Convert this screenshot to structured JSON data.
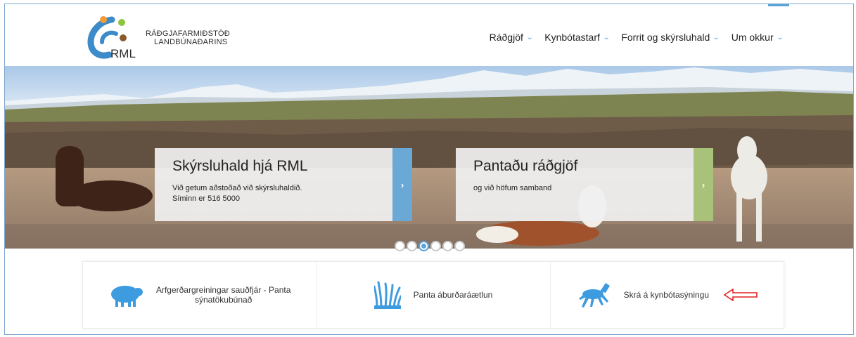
{
  "brand": {
    "name_line1": "RÁÐGJAFARMIÐSTÖÐ",
    "name_line2": "LANDBÚNAÐARINS",
    "logo_text": "RML",
    "colors": {
      "orange": "#f39c34",
      "green": "#8cc63f",
      "brown": "#8b5a2b",
      "blue": "#3d8bc9"
    }
  },
  "nav": {
    "items": [
      {
        "label": "Ráðgjöf",
        "icon": "chevron-down-icon"
      },
      {
        "label": "Kynbótastarf",
        "icon": "chevron-down-icon"
      },
      {
        "label": "Forrit og skýrsluhald",
        "icon": "chevron-down-icon"
      },
      {
        "label": "Um okkur",
        "icon": "chevron-down-icon"
      }
    ]
  },
  "hero": {
    "slides": [
      {
        "title": "Skýrsluhald hjá RML",
        "line1": "Við getum aðstoðað við skýrsluhaldið.",
        "line2": "Síminn er  516 5000",
        "arrow": "›",
        "accent": "#6aa8d6"
      },
      {
        "title": "Pantaðu ráðgjöf",
        "line1": "og við höfum samband",
        "arrow": "›",
        "accent": "#a8c27a"
      }
    ],
    "pager": {
      "count": 6,
      "active_index": 2
    }
  },
  "services": [
    {
      "label_line1": "Arfgerðargreiningar sauðfjár - Panta",
      "label_line2": "sýnatökubúnað",
      "icon": "sheep-icon"
    },
    {
      "label_line1": "Panta áburðaráætlun",
      "icon": "grass-icon"
    },
    {
      "label_line1": "Skrá á kynbótasýningu",
      "icon": "horse-icon"
    }
  ],
  "annotation": {
    "icon": "left-arrow-annotation",
    "color": "#e02020"
  }
}
